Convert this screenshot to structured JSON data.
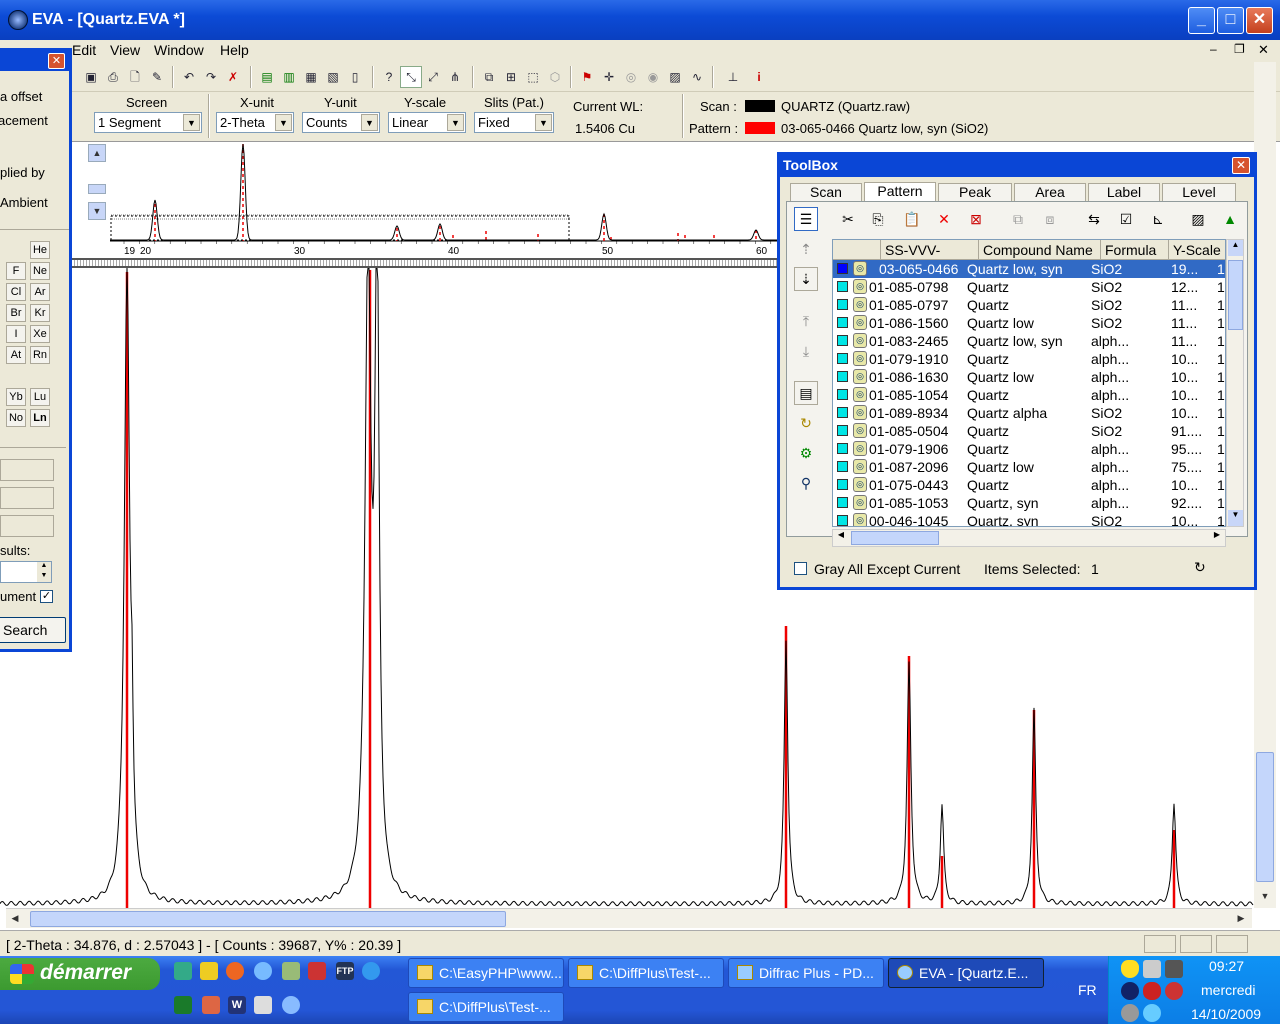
{
  "window": {
    "title": "EVA - [Quartz.EVA *]"
  },
  "menu": [
    "Edit",
    "View",
    "Window",
    "Help"
  ],
  "toolbar2": {
    "screen": {
      "label": "Screen",
      "value": "1 Segment"
    },
    "xunit": {
      "label": "X-unit",
      "value": "2-Theta"
    },
    "yunit": {
      "label": "Y-unit",
      "value": "Counts"
    },
    "yscale": {
      "label": "Y-scale",
      "value": "Linear"
    },
    "slits": {
      "label": "Slits (Pat.)",
      "value": "Fixed"
    },
    "wl_label": "Current WL:",
    "wl_value": "1.5406 Cu",
    "scan_label": "Scan :",
    "scan_value": "QUARTZ (Quartz.raw)",
    "pattern_label": "Pattern :",
    "pattern_value": "03-065-0466 Quartz low, syn (SiO2)",
    "colors": {
      "scan": "#000000",
      "pattern": "#ff0000"
    }
  },
  "overview": {
    "ticks": [
      "19",
      "20",
      "30",
      "40",
      "50",
      "60"
    ]
  },
  "statusbar": "[ 2-Theta : 34.876, d : 2.57043 ] - [ Counts : 39687, Y% : 20.39 ]",
  "left_panel": {
    "texts": [
      "a offset",
      "acement",
      "plied by",
      "Ambient",
      "sults:",
      "ument",
      "Search"
    ],
    "elements": [
      "He",
      "F",
      "Ne",
      "Cl",
      "Ar",
      "Br",
      "Kr",
      "I",
      "Xe",
      "At",
      "Rn",
      "Yb",
      "Lu",
      "No",
      "Ln"
    ]
  },
  "toolbox": {
    "title": "ToolBox",
    "tabs": [
      "Scan",
      "Pattern",
      "Peak",
      "Area",
      "Label",
      "Level"
    ],
    "selected_tab": "Pattern",
    "columns": [
      "SS-VVV-PPPP",
      "Compound Name",
      "Formula",
      "Y-Scale"
    ],
    "rows": [
      {
        "id": "03-065-0466",
        "name": "Quartz low, syn",
        "formula": "SiO2",
        "yscale": "19...",
        "n": "1",
        "color": "#0000ff",
        "selected": true
      },
      {
        "id": "01-085-0798",
        "name": "Quartz",
        "formula": "SiO2",
        "yscale": "12...",
        "n": "1",
        "color": "#00e5e5"
      },
      {
        "id": "01-085-0797",
        "name": "Quartz",
        "formula": "SiO2",
        "yscale": "11...",
        "n": "1",
        "color": "#00e5e5"
      },
      {
        "id": "01-086-1560",
        "name": "Quartz low",
        "formula": "SiO2",
        "yscale": "11...",
        "n": "1",
        "color": "#00e5e5"
      },
      {
        "id": "01-083-2465",
        "name": "Quartz low, syn",
        "formula": "alph...",
        "yscale": "11...",
        "n": "1",
        "color": "#00e5e5"
      },
      {
        "id": "01-079-1910",
        "name": "Quartz",
        "formula": "alph...",
        "yscale": "10...",
        "n": "1",
        "color": "#00e5e5"
      },
      {
        "id": "01-086-1630",
        "name": "Quartz low",
        "formula": "alph...",
        "yscale": "10...",
        "n": "1",
        "color": "#00e5e5"
      },
      {
        "id": "01-085-1054",
        "name": "Quartz",
        "formula": "alph...",
        "yscale": "10...",
        "n": "1",
        "color": "#00e5e5"
      },
      {
        "id": "01-089-8934",
        "name": "Quartz alpha",
        "formula": "SiO2",
        "yscale": "10...",
        "n": "1",
        "color": "#00e5e5"
      },
      {
        "id": "01-085-0504",
        "name": "Quartz",
        "formula": "SiO2",
        "yscale": "91....",
        "n": "1",
        "color": "#00e5e5"
      },
      {
        "id": "01-079-1906",
        "name": "Quartz",
        "formula": "alph...",
        "yscale": "95....",
        "n": "1",
        "color": "#00e5e5"
      },
      {
        "id": "01-087-2096",
        "name": "Quartz low",
        "formula": "alph...",
        "yscale": "75....",
        "n": "1",
        "color": "#00e5e5"
      },
      {
        "id": "01-075-0443",
        "name": "Quartz",
        "formula": "alph...",
        "yscale": "10...",
        "n": "1",
        "color": "#00e5e5"
      },
      {
        "id": "01-085-1053",
        "name": "Quartz, syn",
        "formula": "alph...",
        "yscale": "92....",
        "n": "1",
        "color": "#00e5e5"
      },
      {
        "id": "00-046-1045",
        "name": "Quartz, syn",
        "formula": "SiO2",
        "yscale": "10...",
        "n": "1",
        "color": "#00e5e5"
      }
    ],
    "gray_label": "Gray All Except Current",
    "items_label": "Items Selected:",
    "items_value": "1"
  },
  "taskbar": {
    "start": "démarrer",
    "tasks": [
      "C:\\EasyPHP\\www...",
      "C:\\DiffPlus\\Test-...",
      "Diffrac Plus - PD...",
      "EVA - [Quartz.E...",
      "C:\\DiffPlus\\Test-..."
    ],
    "lang": "FR",
    "time": "09:27",
    "day": "mercredi",
    "date": "14/10/2009"
  }
}
